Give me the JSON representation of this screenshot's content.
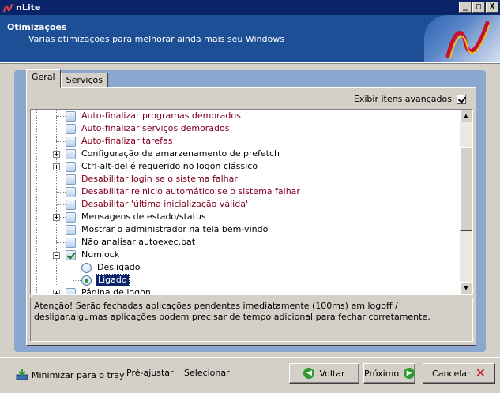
{
  "window": {
    "title": "nLite",
    "controls": [
      "_",
      "□",
      "X"
    ]
  },
  "header": {
    "title": "Otimizações",
    "subtitle": "Varias otimizações para melhorar ainda mais seu Windows"
  },
  "tabs": [
    {
      "label": "Geral",
      "active": true
    },
    {
      "label": "Serviços",
      "active": false
    }
  ],
  "advanced": {
    "label": "Exibir itens avançados",
    "checked": true
  },
  "tree": {
    "items": [
      {
        "label": "Auto-finalizar programas demorados",
        "red": true,
        "expander": "none",
        "checked": false
      },
      {
        "label": "Auto-finalizar serviços demorados",
        "red": true,
        "expander": "none",
        "checked": false
      },
      {
        "label": "Auto-finalizar tarefas",
        "red": true,
        "expander": "none",
        "checked": false
      },
      {
        "label": "Configuração de amarzenamento de prefetch",
        "red": false,
        "expander": "plus",
        "checked": false
      },
      {
        "label": "Ctrl-alt-del é requerido no logon clássico",
        "red": false,
        "expander": "plus",
        "checked": false
      },
      {
        "label": "Desabilitar login se o sistema falhar",
        "red": true,
        "expander": "none",
        "checked": false
      },
      {
        "label": "Desabilitar reinicio automático se o sistema falhar",
        "red": true,
        "expander": "none",
        "checked": false
      },
      {
        "label": "Desabilitar 'última inicialização válida'",
        "red": true,
        "expander": "none",
        "checked": false
      },
      {
        "label": "Mensagens de estado/status",
        "red": false,
        "expander": "plus",
        "checked": false
      },
      {
        "label": "Mostrar o administrador na tela bem-vindo",
        "red": false,
        "expander": "none",
        "checked": false
      },
      {
        "label": "Não analisar autoexec.bat",
        "red": false,
        "expander": "none",
        "checked": false
      },
      {
        "label": "Numlock",
        "red": false,
        "expander": "minus",
        "checked": true
      },
      {
        "label": "Página de logon",
        "red": false,
        "expander": "plus",
        "checked": false
      }
    ],
    "numlock_options": [
      {
        "label": "Desligado",
        "selected": false
      },
      {
        "label": "Ligado",
        "selected": true
      }
    ]
  },
  "description": "Atenção! Serão fechadas aplicações pendentes imediatamente (100ms) em logoff / desligar.algumas aplicações podem precisar de tempo adicional para fechar corretamente.",
  "footer": {
    "minimize": "Minimizar para o tray",
    "preset": "Pré-ajustar",
    "select": "Selecionar",
    "back": "Voltar",
    "next": "Próximo",
    "cancel": "Cancelar"
  }
}
